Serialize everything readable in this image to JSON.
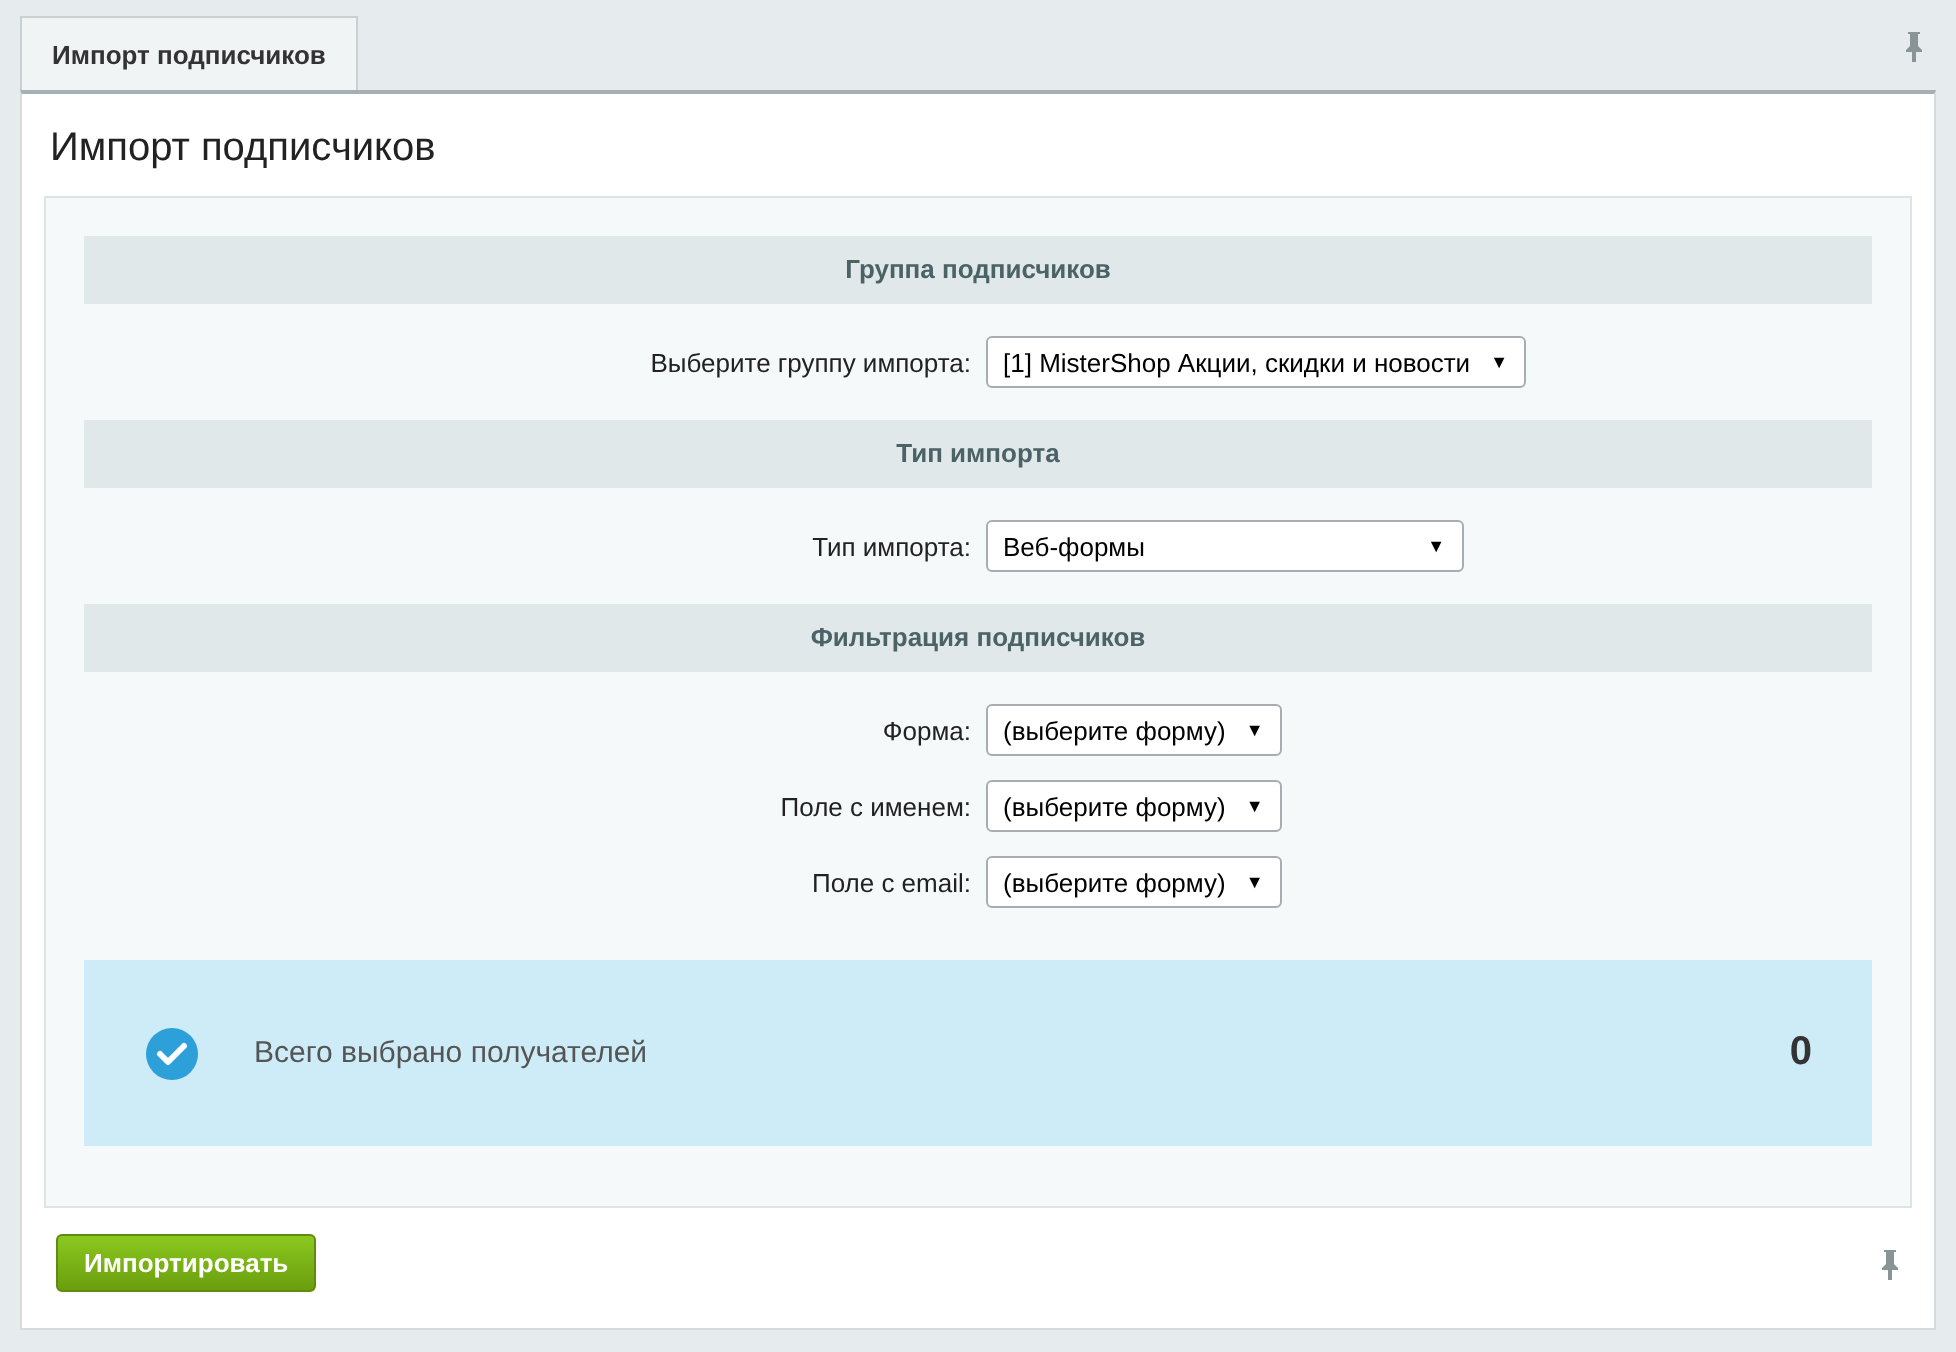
{
  "tabs": [
    {
      "label": "Импорт подписчиков",
      "selected": true
    }
  ],
  "title": "Импорт подписчиков",
  "sections": [
    {
      "heading": "Группа подписчиков",
      "fields": [
        {
          "label": "Выберите группу импорта:",
          "value": "[1] MisterShop Акции, скидки и новости",
          "arrow": "▼"
        }
      ]
    },
    {
      "heading": "Тип импорта",
      "fields": [
        {
          "label": "Тип импорта:",
          "value": "Веб-формы",
          "arrow": "▼"
        }
      ]
    },
    {
      "heading": "Фильтрация подписчиков",
      "fields": [
        {
          "label": "Форма:",
          "value": "(выберите форму)",
          "arrow": "▼"
        },
        {
          "label": "Поле с именем:",
          "value": "(выберите форму)",
          "arrow": "▼"
        },
        {
          "label": "Поле с email:",
          "value": "(выберите форму)",
          "arrow": "▼"
        }
      ]
    }
  ],
  "summary": {
    "label": "Всего выбрано получателей",
    "count": "0"
  },
  "button": "Импортировать"
}
